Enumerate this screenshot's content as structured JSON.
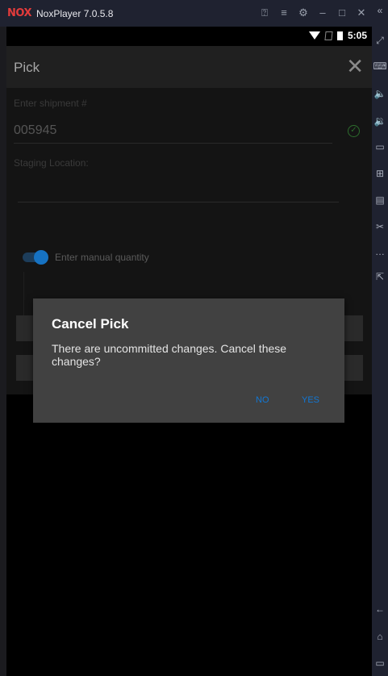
{
  "window": {
    "logo": "NOX",
    "title": "NoxPlayer 7.0.5.8",
    "controls": [
      "help-icon",
      "menu-icon",
      "settings-icon",
      "minimize-icon",
      "maximize-icon",
      "close-icon",
      "collapse-icon"
    ]
  },
  "status_bar": {
    "time": "5:05"
  },
  "app_bar": {
    "title": "Pick",
    "close_glyph": "✕"
  },
  "form": {
    "shipment_label": "Enter shipment #",
    "shipment_value": "005945",
    "staging_label": "Staging Location:",
    "manual_quantity_label": "Enter manual quantity",
    "manual_quantity_on": true
  },
  "dialog": {
    "title": "Cancel Pick",
    "message": "There are uncommitted changes. Cancel these changes?",
    "no_label": "NO",
    "yes_label": "YES"
  },
  "colors": {
    "accent": "#1277d4",
    "dialog_bg": "#414141",
    "brand_red": "#e33b3b"
  }
}
